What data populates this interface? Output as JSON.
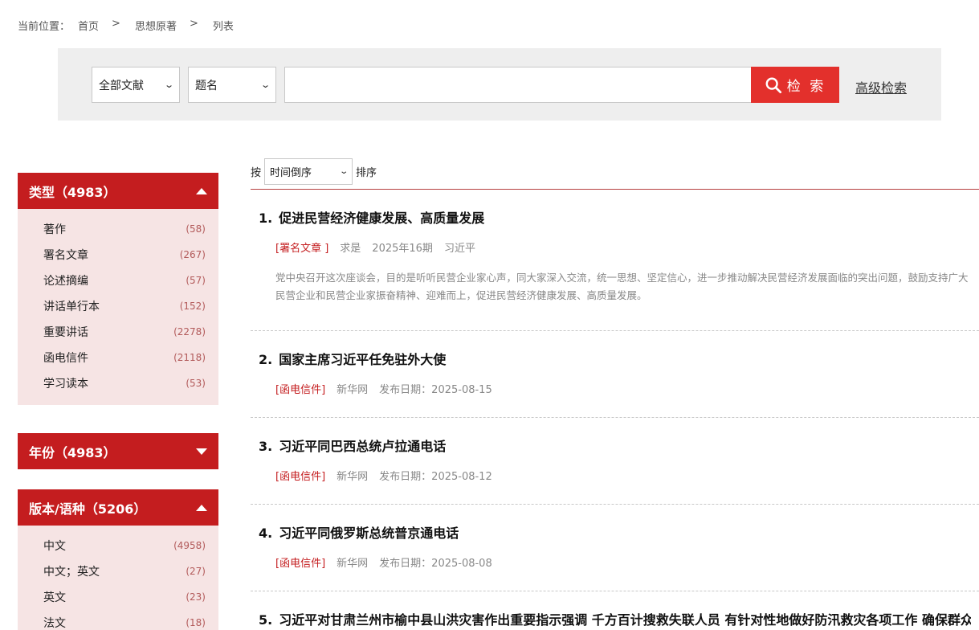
{
  "breadcrumb": {
    "label": "当前位置：",
    "items": [
      "首页",
      "思想原著",
      "列表"
    ],
    "separator": ">"
  },
  "search": {
    "scope_selected": "全部文献",
    "field_selected": "题名",
    "query": "",
    "button_label": "检 索",
    "advanced_label": "高级检索"
  },
  "facets": {
    "type": {
      "title": "类型（4983）",
      "expanded": true,
      "items": [
        {
          "label": "著作",
          "count": "(58)"
        },
        {
          "label": "署名文章",
          "count": "(267)"
        },
        {
          "label": "论述摘编",
          "count": "(57)"
        },
        {
          "label": "讲话单行本",
          "count": "(152)"
        },
        {
          "label": "重要讲话",
          "count": "(2278)"
        },
        {
          "label": "函电信件",
          "count": "(2118)"
        },
        {
          "label": "学习读本",
          "count": "(53)"
        }
      ]
    },
    "year": {
      "title": "年份（4983）",
      "expanded": false
    },
    "edition": {
      "title": "版本/语种（5206）",
      "expanded": true,
      "items": [
        {
          "label": "中文",
          "count": "(4958)"
        },
        {
          "label": "中文；英文",
          "count": "(27)"
        },
        {
          "label": "英文",
          "count": "(23)"
        },
        {
          "label": "法文",
          "count": "(18)"
        }
      ]
    }
  },
  "sort": {
    "prefix": "按",
    "selected": "时间倒序",
    "suffix": "排序"
  },
  "results": [
    {
      "index": "1.",
      "title": "促进民营经济健康发展、高质量发展",
      "tag": "[署名文章 ]",
      "source": "求是",
      "issue": "2025年16期",
      "author": "习近平",
      "abstract": "党中央召开这次座谈会，目的是听听民营企业家心声，同大家深入交流，统一思想、坚定信心，进一步推动解决民营经济发展面临的突出问题，鼓励支持广大民营企业和民营企业家振奋精神、迎难而上，促进民营经济健康发展、高质量发展。"
    },
    {
      "index": "2.",
      "title": "国家主席习近平任免驻外大使",
      "tag": "[函电信件]",
      "source": "新华网",
      "date": "发布日期：2025-08-15"
    },
    {
      "index": "3.",
      "title": "习近平同巴西总统卢拉通电话",
      "tag": "[函电信件]",
      "source": "新华网",
      "date": "发布日期：2025-08-12"
    },
    {
      "index": "4.",
      "title": "习近平同俄罗斯总统普京通电话",
      "tag": "[函电信件]",
      "source": "新华网",
      "date": "发布日期：2025-08-08"
    },
    {
      "index": "5.",
      "title": "习近平对甘肃兰州市榆中县山洪灾害作出重要指示强调 千方百计搜救失联人员 有针对性地做好防汛救灾各项工作 确保群众"
    }
  ],
  "colors": {
    "accent_red": "#c41d1f",
    "search_red": "#e3302c",
    "facet_bg": "#f6e4e4",
    "band_bg": "#eeeeee"
  }
}
